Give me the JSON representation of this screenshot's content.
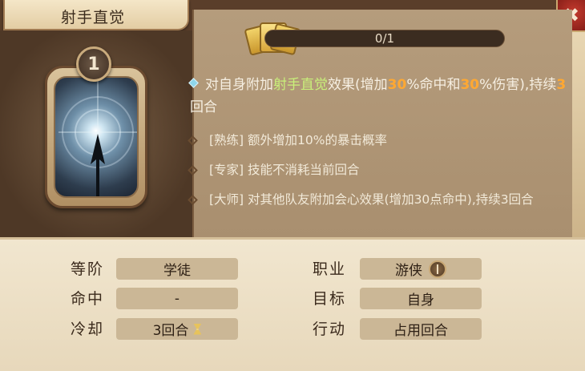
{
  "window": {
    "title": "射手直觉",
    "close_label": "✖"
  },
  "card": {
    "level_badge": "1",
    "icon": "arrow-in-light-icon"
  },
  "progress": {
    "value": 0,
    "max": 1,
    "text": "0/1"
  },
  "description": {
    "main_prefix": "对自身附加",
    "skill_name": "射手直觉",
    "main_mid1": "效果(增加",
    "hit_pct": "30",
    "main_mid2": "%命中和",
    "dmg_pct": "30",
    "main_mid3": "%伤害),持续",
    "turns": "3",
    "main_suffix": "回合"
  },
  "masteries": [
    {
      "text": "[熟练] 额外增加10%的暴击概率"
    },
    {
      "text": "[专家] 技能不消耗当前回合"
    },
    {
      "text": "[大师] 对其他队友附加会心效果(增加30点命中),持续3回合"
    }
  ],
  "stats": {
    "rank_label": "等阶",
    "rank_value": "学徒",
    "class_label": "职业",
    "class_value": "游侠",
    "hit_label": "命中",
    "hit_value": "-",
    "target_label": "目标",
    "target_value": "自身",
    "cooldown_label": "冷却",
    "cooldown_value": "3回合",
    "action_label": "行动",
    "action_value": "占用回合"
  },
  "colors": {
    "highlight_green": "#c9f07a",
    "highlight_orange": "#ffa832",
    "progress_fill": "#c99a3d"
  }
}
